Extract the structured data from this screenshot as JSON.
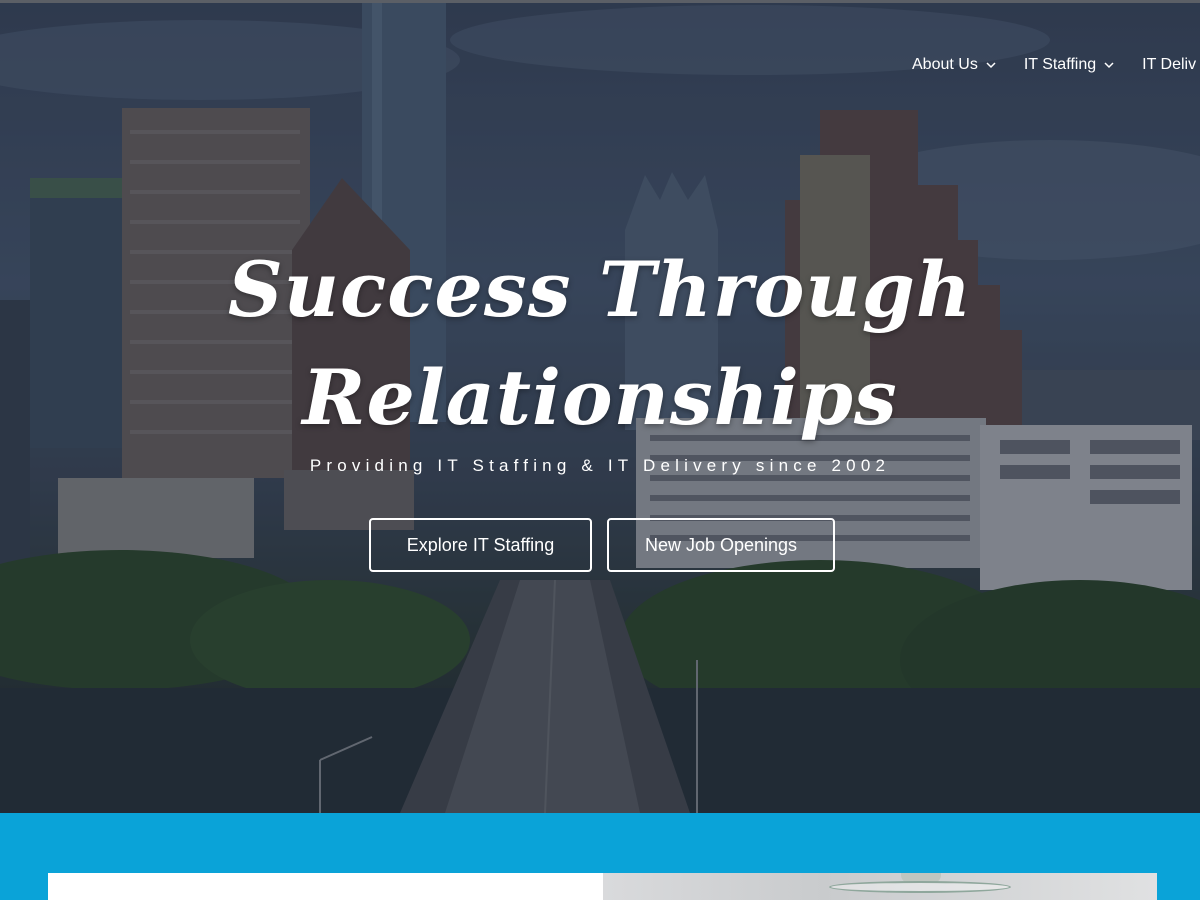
{
  "nav": {
    "items": [
      {
        "label": "About Us",
        "has_dropdown": true
      },
      {
        "label": "IT Staffing",
        "has_dropdown": true
      },
      {
        "label": "IT Deliv",
        "has_dropdown": false
      }
    ]
  },
  "hero": {
    "headline_line1": "Success Through",
    "headline_line2": "Relationships",
    "tagline": "Providing IT Staffing & IT Delivery since 2002",
    "buttons": {
      "explore_label": "Explore IT Staffing",
      "jobs_label": "New Job Openings"
    }
  },
  "colors": {
    "band": "#0aa3d8",
    "text": "#ffffff"
  }
}
